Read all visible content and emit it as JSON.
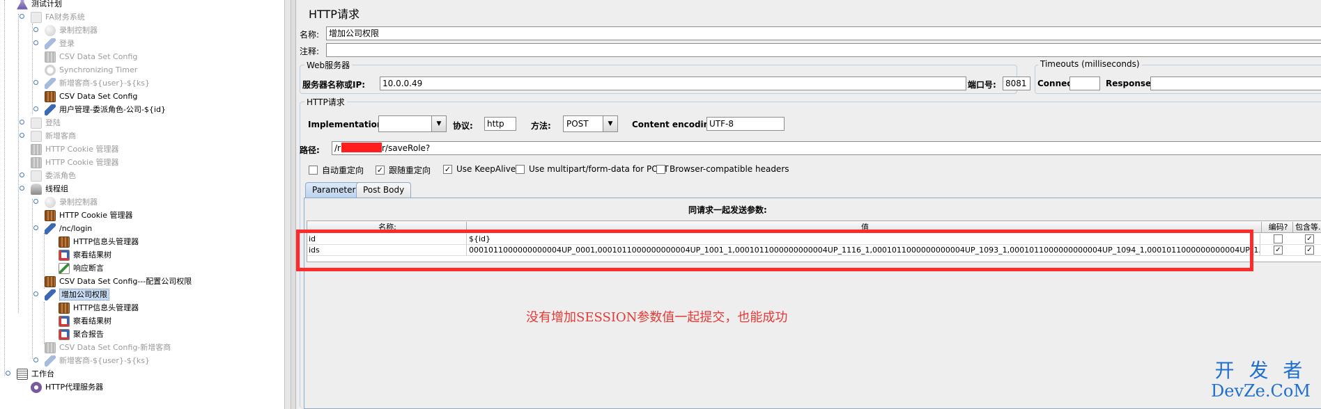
{
  "tree": {
    "items": [
      {
        "label": "测试计划",
        "disabled": false,
        "selected": false
      },
      {
        "label": "FA财务系统",
        "disabled": true,
        "selected": false
      },
      {
        "label": "录制控制器",
        "disabled": true,
        "selected": false
      },
      {
        "label": "登录",
        "disabled": true,
        "selected": false
      },
      {
        "label": "CSV Data Set Config",
        "disabled": true,
        "selected": false
      },
      {
        "label": "Synchronizing Timer",
        "disabled": true,
        "selected": false
      },
      {
        "label": "新增客商-${user}-${ks}",
        "disabled": true,
        "selected": false
      },
      {
        "label": "CSV Data Set Config",
        "disabled": false,
        "selected": false
      },
      {
        "label": "用户管理-委派角色-公司-${id}",
        "disabled": false,
        "selected": false
      },
      {
        "label": "登陆",
        "disabled": true,
        "selected": false
      },
      {
        "label": "新增客商",
        "disabled": true,
        "selected": false
      },
      {
        "label": "HTTP Cookie 管理器",
        "disabled": true,
        "selected": false
      },
      {
        "label": "HTTP Cookie 管理器",
        "disabled": true,
        "selected": false
      },
      {
        "label": "委派角色",
        "disabled": true,
        "selected": false
      },
      {
        "label": "线程组",
        "disabled": false,
        "selected": false
      },
      {
        "label": "录制控制器",
        "disabled": true,
        "selected": false
      },
      {
        "label": "HTTP Cookie 管理器",
        "disabled": false,
        "selected": false
      },
      {
        "label": "/nc/login",
        "disabled": false,
        "selected": false
      },
      {
        "label": "HTTP信息头管理器",
        "disabled": false,
        "selected": false
      },
      {
        "label": "察看结果树",
        "disabled": false,
        "selected": false
      },
      {
        "label": "响应断言",
        "disabled": false,
        "selected": false
      },
      {
        "label": "CSV Data Set Config---配置公司权限",
        "disabled": false,
        "selected": false
      },
      {
        "label": "增加公司权限",
        "disabled": false,
        "selected": true
      },
      {
        "label": "HTTP信息头管理器",
        "disabled": false,
        "selected": false
      },
      {
        "label": "察看结果树",
        "disabled": false,
        "selected": false
      },
      {
        "label": "聚合报告",
        "disabled": false,
        "selected": false
      },
      {
        "label": "CSV Data Set Config-新增客商",
        "disabled": true,
        "selected": false
      },
      {
        "label": "新增客商-${user}-${ks}",
        "disabled": true,
        "selected": false
      },
      {
        "label": "工作台",
        "disabled": false,
        "selected": false
      },
      {
        "label": "HTTP代理服务器",
        "disabled": false,
        "selected": false
      }
    ]
  },
  "form": {
    "title": "HTTP请求",
    "name_label": "名称:",
    "name_value": "增加公司权限",
    "comment_label": "注释:",
    "comment_value": "",
    "web_server": {
      "title": "Web服务器",
      "server_label": "服务器名称或IP:",
      "server_value": "10.0.0.49",
      "port_label": "端口号:",
      "port_value": "8081"
    },
    "timeouts": {
      "title": "Timeouts (milliseconds)",
      "connect_label": "Connect:",
      "connect_value": "",
      "response_label": "Response:",
      "response_value": ""
    },
    "http_request": {
      "title": "HTTP请求",
      "implementation_label": "Implementation:",
      "implementation_value": "",
      "protocol_label": "协议:",
      "protocol_value": "http",
      "method_label": "方法:",
      "method_value": "POST",
      "encoding_label": "Content encoding:",
      "encoding_value": "UTF-8",
      "path_label": "路径:",
      "path_prefix": "/r",
      "path_suffix": "r/saveRole?"
    },
    "options": [
      {
        "label": "自动重定向",
        "checked": false
      },
      {
        "label": "跟随重定向",
        "checked": true
      },
      {
        "label": "Use KeepAlive",
        "checked": true
      },
      {
        "label": "Use multipart/form-data for POST",
        "checked": false
      },
      {
        "label": "Browser-compatible headers",
        "checked": false
      }
    ],
    "tabs": [
      {
        "label": "Parameters",
        "active": true
      },
      {
        "label": "Post Body",
        "active": false
      }
    ],
    "params_caption": "同请求一起发送参数:",
    "columns": {
      "name": "名称:",
      "value": "值",
      "encode": "编码?",
      "include": "包含等..."
    },
    "params": [
      {
        "name": "id",
        "value": "${id}",
        "encode": false,
        "include": true
      },
      {
        "name": "ids",
        "value": "0001011000000000004UP_0001,0001011000000000004UP_1001_1,0001011000000000004UP_1116_1,0001011000000000004UP_1093_1,0001011000000000004UP_1094_1,0001011000000000004UP_1...",
        "encode": true,
        "include": true
      }
    ]
  },
  "annotation": {
    "text": "没有增加SESSION参数值一起提交，也能成功",
    "color": "#e53935"
  },
  "watermark": {
    "line1": "开 发 者",
    "line2": "DevZe.CoM",
    "color": "#1f6fcf"
  },
  "colors": {
    "highlight_box": "#ff2b2b",
    "selection": "#c8dcf3"
  }
}
